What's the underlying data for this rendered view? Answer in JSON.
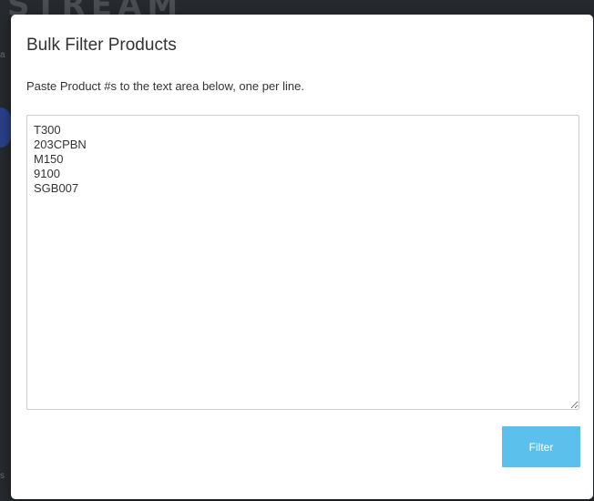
{
  "background": {
    "logo_text": "STREAM",
    "edge_letter_top": "a",
    "edge_letter_bottom": "s"
  },
  "modal": {
    "title": "Bulk Filter Products",
    "instructions": "Paste Product #s to the text area below, one per line.",
    "textarea_lines": [
      "T300",
      "203CPBN",
      "M150",
      "9100",
      "SGB007"
    ],
    "filter_label": "Filter"
  },
  "colors": {
    "button_bg": "#5bc0eb",
    "overlay": "#26292d",
    "text": "#333333"
  }
}
